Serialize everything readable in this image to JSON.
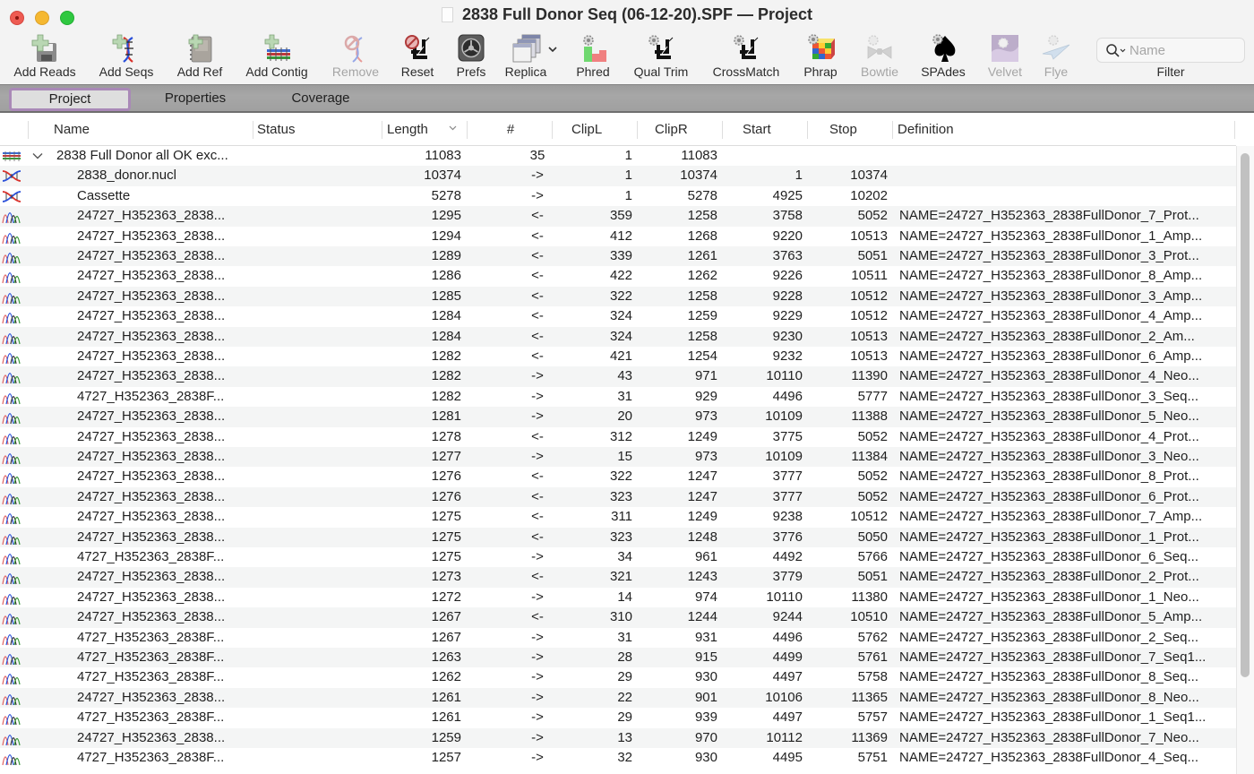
{
  "window": {
    "title": "2838 Full Donor Seq (06-12-20).SPF — Project"
  },
  "toolbar": {
    "buttons": [
      {
        "id": "add-reads",
        "label": "Add Reads",
        "icon": "floppy-plus-icon",
        "enabled": true
      },
      {
        "id": "add-seqs",
        "label": "Add Seqs",
        "icon": "dna-plus-icon",
        "enabled": true
      },
      {
        "id": "add-ref",
        "label": "Add Ref",
        "icon": "notebook-plus-icon",
        "enabled": true
      },
      {
        "id": "add-contig",
        "label": "Add Contig",
        "icon": "contig-plus-icon",
        "enabled": true
      },
      {
        "id": "remove",
        "label": "Remove",
        "icon": "dna-remove-icon",
        "enabled": false
      },
      {
        "id": "reset",
        "label": "Reset",
        "icon": "crop-reset-icon",
        "enabled": true
      },
      {
        "id": "prefs",
        "label": "Prefs",
        "icon": "gear-prefs-icon",
        "enabled": true
      },
      {
        "id": "replica",
        "label": "Replica",
        "icon": "windows-stack-icon",
        "enabled": true
      },
      {
        "id": "phred",
        "label": "Phred",
        "icon": "phred-bars-icon",
        "enabled": true
      },
      {
        "id": "qual-trim",
        "label": "Qual Trim",
        "icon": "crop-gear-icon",
        "enabled": true
      },
      {
        "id": "crossmatch",
        "label": "CrossMatch",
        "icon": "crop-gear-icon",
        "enabled": true
      },
      {
        "id": "phrap",
        "label": "Phrap",
        "icon": "rubiks-cube-icon",
        "enabled": true
      },
      {
        "id": "bowtie",
        "label": "Bowtie",
        "icon": "bowtie-icon",
        "enabled": false
      },
      {
        "id": "spades",
        "label": "SPAdes",
        "icon": "spade-icon",
        "enabled": true
      },
      {
        "id": "velvet",
        "label": "Velvet",
        "icon": "velvet-icon",
        "enabled": false
      },
      {
        "id": "flye",
        "label": "Flye",
        "icon": "paper-plane-icon",
        "enabled": false
      }
    ],
    "filter": {
      "placeholder": "Name",
      "value": "",
      "label": "Filter"
    }
  },
  "tabs": [
    {
      "label": "Project",
      "active": true
    },
    {
      "label": "Properties",
      "active": false
    },
    {
      "label": "Coverage",
      "active": false
    }
  ],
  "table": {
    "columns": [
      "Name",
      "Status",
      "Length",
      "#",
      "ClipL",
      "ClipR",
      "Start",
      "Stop",
      "Definition"
    ],
    "sorted_column": "Length",
    "sort_direction": "descending",
    "rows": [
      {
        "type": "contig",
        "expanded": true,
        "name": "2838 Full Donor all OK exc...",
        "status": "",
        "length": "11083",
        "num": "35",
        "clipl": "1",
        "clipr": "11083",
        "start": "",
        "stop": "",
        "definition": ""
      },
      {
        "type": "reference",
        "name": "2838_donor.nucl",
        "status": "",
        "length": "10374",
        "num": "->",
        "clipl": "1",
        "clipr": "10374",
        "start": "1",
        "stop": "10374",
        "definition": ""
      },
      {
        "type": "reference",
        "name": "Cassette",
        "status": "",
        "length": "5278",
        "num": "->",
        "clipl": "1",
        "clipr": "5278",
        "start": "4925",
        "stop": "10202",
        "definition": ""
      },
      {
        "type": "read",
        "name": "24727_H352363_2838...",
        "status": "",
        "length": "1295",
        "num": "<-",
        "clipl": "359",
        "clipr": "1258",
        "start": "3758",
        "stop": "5052",
        "definition": "NAME=24727_H352363_2838FullDonor_7_Prot..."
      },
      {
        "type": "read",
        "name": "24727_H352363_2838...",
        "status": "",
        "length": "1294",
        "num": "<-",
        "clipl": "412",
        "clipr": "1268",
        "start": "9220",
        "stop": "10513",
        "definition": "NAME=24727_H352363_2838FullDonor_1_Amp..."
      },
      {
        "type": "read",
        "name": "24727_H352363_2838...",
        "status": "",
        "length": "1289",
        "num": "<-",
        "clipl": "339",
        "clipr": "1261",
        "start": "3763",
        "stop": "5051",
        "definition": "NAME=24727_H352363_2838FullDonor_3_Prot..."
      },
      {
        "type": "read",
        "name": "24727_H352363_2838...",
        "status": "",
        "length": "1286",
        "num": "<-",
        "clipl": "422",
        "clipr": "1262",
        "start": "9226",
        "stop": "10511",
        "definition": "NAME=24727_H352363_2838FullDonor_8_Amp..."
      },
      {
        "type": "read",
        "name": "24727_H352363_2838...",
        "status": "",
        "length": "1285",
        "num": "<-",
        "clipl": "322",
        "clipr": "1258",
        "start": "9228",
        "stop": "10512",
        "definition": "NAME=24727_H352363_2838FullDonor_3_Amp..."
      },
      {
        "type": "read",
        "name": "24727_H352363_2838...",
        "status": "",
        "length": "1284",
        "num": "<-",
        "clipl": "324",
        "clipr": "1259",
        "start": "9229",
        "stop": "10512",
        "definition": "NAME=24727_H352363_2838FullDonor_4_Amp..."
      },
      {
        "type": "read",
        "name": "24727_H352363_2838...",
        "status": "",
        "length": "1284",
        "num": "<-",
        "clipl": "324",
        "clipr": "1258",
        "start": "9230",
        "stop": "10513",
        "definition": "NAME=24727_H352363_2838FullDonor_2_Am..."
      },
      {
        "type": "read",
        "name": "24727_H352363_2838...",
        "status": "",
        "length": "1282",
        "num": "<-",
        "clipl": "421",
        "clipr": "1254",
        "start": "9232",
        "stop": "10513",
        "definition": "NAME=24727_H352363_2838FullDonor_6_Amp..."
      },
      {
        "type": "read",
        "name": "24727_H352363_2838...",
        "status": "",
        "length": "1282",
        "num": "->",
        "clipl": "43",
        "clipr": "971",
        "start": "10110",
        "stop": "11390",
        "definition": "NAME=24727_H352363_2838FullDonor_4_Neo..."
      },
      {
        "type": "read",
        "name": "4727_H352363_2838F...",
        "status": "",
        "length": "1282",
        "num": "->",
        "clipl": "31",
        "clipr": "929",
        "start": "4496",
        "stop": "5777",
        "definition": "NAME=24727_H352363_2838FullDonor_3_Seq..."
      },
      {
        "type": "read",
        "name": "24727_H352363_2838...",
        "status": "",
        "length": "1281",
        "num": "->",
        "clipl": "20",
        "clipr": "973",
        "start": "10109",
        "stop": "11388",
        "definition": "NAME=24727_H352363_2838FullDonor_5_Neo..."
      },
      {
        "type": "read",
        "name": "24727_H352363_2838...",
        "status": "",
        "length": "1278",
        "num": "<-",
        "clipl": "312",
        "clipr": "1249",
        "start": "3775",
        "stop": "5052",
        "definition": "NAME=24727_H352363_2838FullDonor_4_Prot..."
      },
      {
        "type": "read",
        "name": "24727_H352363_2838...",
        "status": "",
        "length": "1277",
        "num": "->",
        "clipl": "15",
        "clipr": "973",
        "start": "10109",
        "stop": "11384",
        "definition": "NAME=24727_H352363_2838FullDonor_3_Neo..."
      },
      {
        "type": "read",
        "name": "24727_H352363_2838...",
        "status": "",
        "length": "1276",
        "num": "<-",
        "clipl": "322",
        "clipr": "1247",
        "start": "3777",
        "stop": "5052",
        "definition": "NAME=24727_H352363_2838FullDonor_8_Prot..."
      },
      {
        "type": "read",
        "name": "24727_H352363_2838...",
        "status": "",
        "length": "1276",
        "num": "<-",
        "clipl": "323",
        "clipr": "1247",
        "start": "3777",
        "stop": "5052",
        "definition": "NAME=24727_H352363_2838FullDonor_6_Prot..."
      },
      {
        "type": "read",
        "name": "24727_H352363_2838...",
        "status": "",
        "length": "1275",
        "num": "<-",
        "clipl": "311",
        "clipr": "1249",
        "start": "9238",
        "stop": "10512",
        "definition": "NAME=24727_H352363_2838FullDonor_7_Amp..."
      },
      {
        "type": "read",
        "name": "24727_H352363_2838...",
        "status": "",
        "length": "1275",
        "num": "<-",
        "clipl": "323",
        "clipr": "1248",
        "start": "3776",
        "stop": "5050",
        "definition": "NAME=24727_H352363_2838FullDonor_1_Prot..."
      },
      {
        "type": "read",
        "name": "4727_H352363_2838F...",
        "status": "",
        "length": "1275",
        "num": "->",
        "clipl": "34",
        "clipr": "961",
        "start": "4492",
        "stop": "5766",
        "definition": "NAME=24727_H352363_2838FullDonor_6_Seq..."
      },
      {
        "type": "read",
        "name": "24727_H352363_2838...",
        "status": "",
        "length": "1273",
        "num": "<-",
        "clipl": "321",
        "clipr": "1243",
        "start": "3779",
        "stop": "5051",
        "definition": "NAME=24727_H352363_2838FullDonor_2_Prot..."
      },
      {
        "type": "read",
        "name": "24727_H352363_2838...",
        "status": "",
        "length": "1272",
        "num": "->",
        "clipl": "14",
        "clipr": "974",
        "start": "10110",
        "stop": "11380",
        "definition": "NAME=24727_H352363_2838FullDonor_1_Neo..."
      },
      {
        "type": "read",
        "name": "24727_H352363_2838...",
        "status": "",
        "length": "1267",
        "num": "<-",
        "clipl": "310",
        "clipr": "1244",
        "start": "9244",
        "stop": "10510",
        "definition": "NAME=24727_H352363_2838FullDonor_5_Amp..."
      },
      {
        "type": "read",
        "name": "4727_H352363_2838F...",
        "status": "",
        "length": "1267",
        "num": "->",
        "clipl": "31",
        "clipr": "931",
        "start": "4496",
        "stop": "5762",
        "definition": "NAME=24727_H352363_2838FullDonor_2_Seq..."
      },
      {
        "type": "read",
        "name": "4727_H352363_2838F...",
        "status": "",
        "length": "1263",
        "num": "->",
        "clipl": "28",
        "clipr": "915",
        "start": "4499",
        "stop": "5761",
        "definition": "NAME=24727_H352363_2838FullDonor_7_Seq1..."
      },
      {
        "type": "read",
        "name": "4727_H352363_2838F...",
        "status": "",
        "length": "1262",
        "num": "->",
        "clipl": "29",
        "clipr": "930",
        "start": "4497",
        "stop": "5758",
        "definition": "NAME=24727_H352363_2838FullDonor_8_Seq..."
      },
      {
        "type": "read",
        "name": "24727_H352363_2838...",
        "status": "",
        "length": "1261",
        "num": "->",
        "clipl": "22",
        "clipr": "901",
        "start": "10106",
        "stop": "11365",
        "definition": "NAME=24727_H352363_2838FullDonor_8_Neo..."
      },
      {
        "type": "read",
        "name": "4727_H352363_2838F...",
        "status": "",
        "length": "1261",
        "num": "->",
        "clipl": "29",
        "clipr": "939",
        "start": "4497",
        "stop": "5757",
        "definition": "NAME=24727_H352363_2838FullDonor_1_Seq1..."
      },
      {
        "type": "read",
        "name": "24727_H352363_2838...",
        "status": "",
        "length": "1259",
        "num": "->",
        "clipl": "13",
        "clipr": "970",
        "start": "10112",
        "stop": "11369",
        "definition": "NAME=24727_H352363_2838FullDonor_7_Neo..."
      },
      {
        "type": "read",
        "name": "4727_H352363_2838F...",
        "status": "",
        "length": "1257",
        "num": "->",
        "clipl": "32",
        "clipr": "930",
        "start": "4495",
        "stop": "5751",
        "definition": "NAME=24727_H352363_2838FullDonor_4_Seq..."
      }
    ]
  },
  "colors": {
    "active_tab_border": "#a989b7",
    "row_alt": "#f4f5f5",
    "tabstrip": "#a0a0a0"
  }
}
